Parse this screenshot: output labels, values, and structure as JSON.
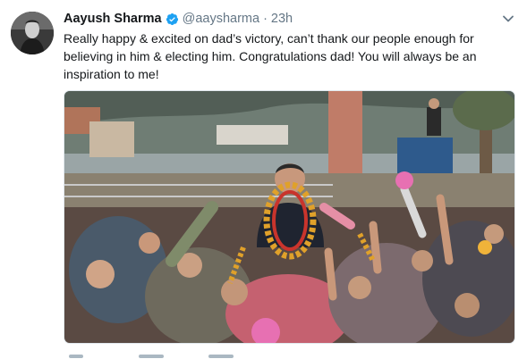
{
  "tweet": {
    "display_name": "Aayush Sharma",
    "handle": "@aaysharma",
    "separator": "·",
    "time": "23h",
    "text": "Really happy & excited on dad’s victory, can’t thank our people enough for believing in him & electing him. Congratulations dad! You will always be an inspiration to me!",
    "verified_icon": "verified-badge-icon",
    "menu_icon": "chevron-down-icon",
    "accent_color": "#1da1f2"
  }
}
